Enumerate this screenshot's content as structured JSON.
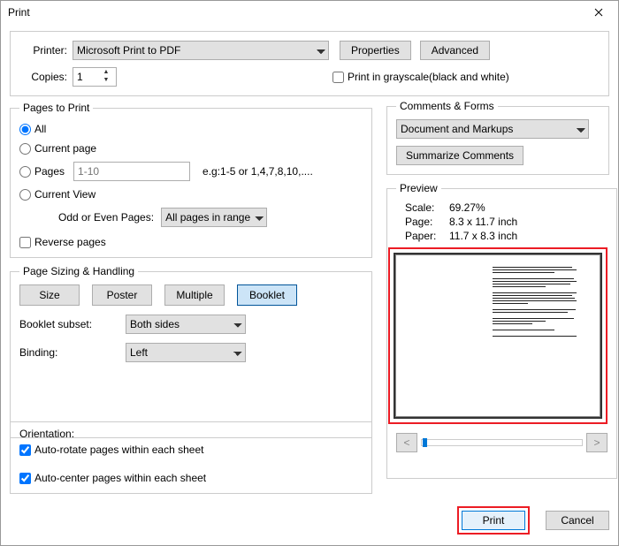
{
  "window": {
    "title": "Print"
  },
  "top": {
    "printer_label": "Printer:",
    "printer_value": "Microsoft Print to PDF",
    "properties_btn": "Properties",
    "advanced_btn": "Advanced",
    "copies_label": "Copies:",
    "copies_value": "1",
    "grayscale_label": "Print in grayscale(black and white)"
  },
  "pages": {
    "legend": "Pages to Print",
    "all": "All",
    "current": "Current page",
    "pages_label": "Pages",
    "pages_placeholder": "1-10",
    "pages_hint": "e.g:1-5 or 1,4,7,8,10,....",
    "current_view": "Current View",
    "odd_even_label": "Odd or Even Pages:",
    "odd_even_value": "All pages in range",
    "reverse": "Reverse pages"
  },
  "sizing": {
    "legend": "Page Sizing & Handling",
    "size": "Size",
    "poster": "Poster",
    "multiple": "Multiple",
    "booklet": "Booklet",
    "subset_label": "Booklet subset:",
    "subset_value": "Both sides",
    "binding_label": "Binding:",
    "binding_value": "Left"
  },
  "orientation": {
    "legend": "Orientation:",
    "auto_rotate": "Auto-rotate pages within each sheet",
    "auto_center": "Auto-center pages within each sheet"
  },
  "comments": {
    "legend": "Comments & Forms",
    "value": "Document and Markups",
    "summarize": "Summarize Comments"
  },
  "preview": {
    "legend": "Preview",
    "scale_k": "Scale:",
    "scale_v": "69.27%",
    "page_k": "Page:",
    "page_v": "8.3 x 11.7 inch",
    "paper_k": "Paper:",
    "paper_v": "11.7 x 8.3 inch",
    "prev": "<",
    "next": ">"
  },
  "footer": {
    "print": "Print",
    "cancel": "Cancel"
  }
}
